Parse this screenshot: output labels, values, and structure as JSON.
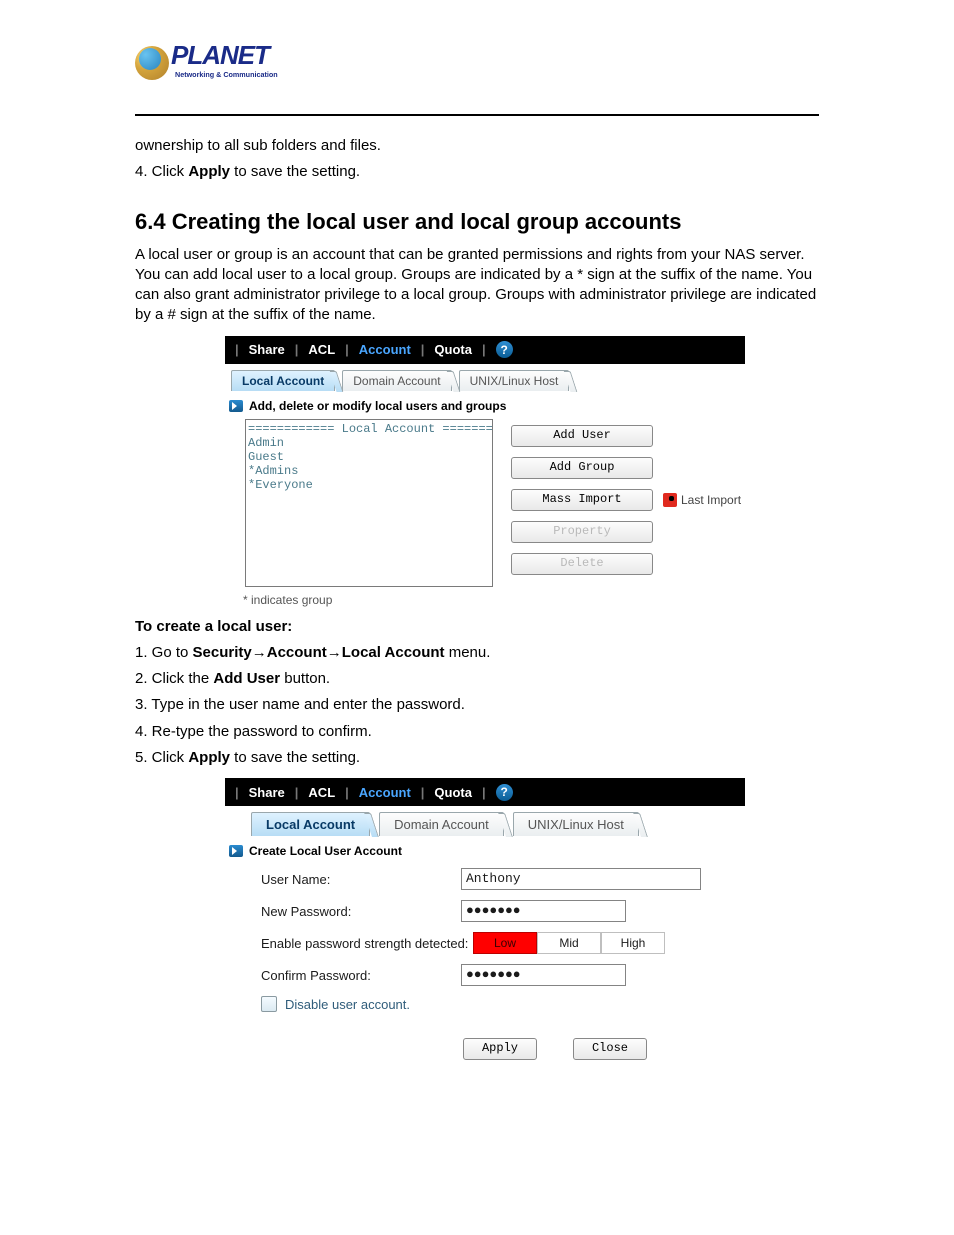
{
  "logo": {
    "brand": "PLANET",
    "tagline": "Networking & Communication"
  },
  "body": {
    "p_owner": "ownership to all sub folders and files.",
    "p_apply4_prefix": "4. Click ",
    "p_apply4_bold": "Apply",
    "p_apply4_suffix": " to save the setting.",
    "h2": "6.4 Creating the local user and local group accounts",
    "p_intro": "A local user or group is an account that can be granted permissions and rights from your NAS server. You can add local user to a local group. Groups are indicated by a * sign at the suffix of the name. You can also grant administrator privilege to a local group. Groups with administrator privilege are indicated by a # sign at the suffix of the name.",
    "p_create_hdr": "To create a local user:",
    "step1_prefix": "1. Go to ",
    "step1_b1": "Security",
    "step1_b2": "Account",
    "step1_b3": "Local Account",
    "step1_suffix": " menu.",
    "step2_prefix": "2. Click the ",
    "step2_bold": "Add User",
    "step2_suffix": " button.",
    "step3": "3. Type in the user name and enter the password.",
    "step4": "4. Re-type the password to confirm.",
    "step5_prefix": "5. Click ",
    "step5_bold": "Apply",
    "step5_suffix": " to save the setting."
  },
  "ss1": {
    "topbar": {
      "share": "Share",
      "acl": "ACL",
      "account": "Account",
      "quota": "Quota"
    },
    "tabs": {
      "local": "Local Account",
      "domain": "Domain Account",
      "unix": "UNIX/Linux Host"
    },
    "section": "Add, delete or modify local users and groups",
    "list": {
      "hdr": "============ Local Account =============",
      "items": [
        "Admin",
        "Guest",
        "*Admins",
        "*Everyone"
      ]
    },
    "buttons": {
      "add_user": "Add User",
      "add_group": "Add Group",
      "mass_import": "Mass Import",
      "property": "Property",
      "delete": "Delete"
    },
    "last_import": "Last Import",
    "footnote": "* indicates group"
  },
  "ss2": {
    "topbar": {
      "share": "Share",
      "acl": "ACL",
      "account": "Account",
      "quota": "Quota"
    },
    "tabs": {
      "local": "Local Account",
      "domain": "Domain Account",
      "unix": "UNIX/Linux Host"
    },
    "section": "Create Local User Account",
    "fields": {
      "user_name_lbl": "User Name:",
      "user_name_val": "Anthony",
      "new_pw_lbl": "New Password:",
      "new_pw_val": "●●●●●●●",
      "strength_lbl": "Enable password strength detected:",
      "strength_low": "Low",
      "strength_mid": "Mid",
      "strength_high": "High",
      "confirm_lbl": "Confirm Password:",
      "confirm_val": "●●●●●●●",
      "disable_lbl": "Disable user account."
    },
    "buttons": {
      "apply": "Apply",
      "close": "Close"
    }
  }
}
